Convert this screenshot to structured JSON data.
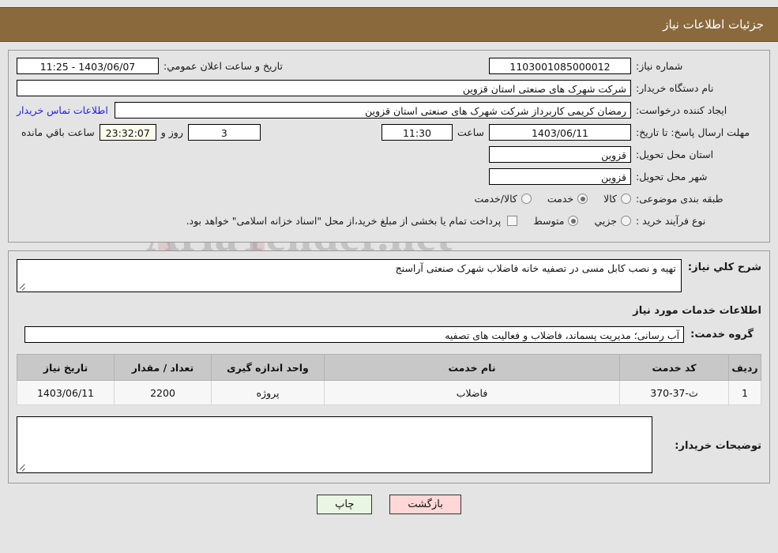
{
  "header": {
    "title": "جزئیات اطلاعات نیاز"
  },
  "form": {
    "need_number_label": "شماره نیاز:",
    "need_number_value": "1103001085000012",
    "public_announce_label": "تاریخ و ساعت اعلان عمومي:",
    "public_announce_value": "1403/06/07 - 11:25",
    "buyer_org_label": "نام دستگاه خریدار:",
    "buyer_org_value": "شرکت شهرک های صنعتی استان قزوین",
    "creator_label": "ایجاد کننده درخواست:",
    "creator_value": "رمضان کریمی کاربرداز شرکت شهرک های صنعتی استان قزوین",
    "contact_link": "اطلاعات تماس خریدار",
    "deadline_label": "مهلت ارسال پاسخ: تا تاریخ:",
    "deadline_date": "1403/06/11",
    "deadline_hour_label": "ساعت",
    "deadline_hour_value": "11:30",
    "remaining_days_value": "3",
    "remaining_days_label": "روز و",
    "remaining_time_value": "23:32:07",
    "remaining_time_label": "ساعت باقي مانده",
    "province_label": "استان محل تحویل:",
    "province_value": "قزوین",
    "city_label": "شهر محل تحویل:",
    "city_value": "قزوین",
    "category_label": "طبقه بندی موضوعی:",
    "category_options": [
      {
        "label": "کالا",
        "selected": false
      },
      {
        "label": "خدمت",
        "selected": true
      },
      {
        "label": "کالا/خدمت",
        "selected": false
      }
    ],
    "process_label": "نوع فرآیند خرید :",
    "process_options": [
      {
        "label": "جزیي",
        "selected": false
      },
      {
        "label": "متوسط",
        "selected": true
      }
    ],
    "treasury_checkbox_checked": false,
    "treasury_note": "پرداخت تمام یا بخشی از مبلغ خرید،از محل \"اسناد خزانه اسلامی\" خواهد بود."
  },
  "details": {
    "general_desc_label": "شرح کلي نیاز:",
    "general_desc_value": "تهیه و نصب کابل مسی در تصفیه خانه فاضلاب شهرک صنعتی آراسنج",
    "section_title": "اطلاعات خدمات مورد نیاز",
    "service_group_label": "گروه خدمت:",
    "service_group_value": "آب رسانی؛ مدیریت پسماند، فاضلاب و فعالیت های تصفیه",
    "buyer_notes_label": "توضیحات خریدار:",
    "buyer_notes_value": ""
  },
  "table": {
    "columns": [
      "ردیف",
      "کد خدمت",
      "نام خدمت",
      "واحد اندازه گیری",
      "تعداد / مقدار",
      "تاریخ نیاز"
    ],
    "rows": [
      {
        "index": "1",
        "code": "ث-37-370",
        "name": "فاضلاب",
        "unit": "پروژه",
        "quantity": "2200",
        "date": "1403/06/11"
      }
    ]
  },
  "buttons": {
    "print": "چاپ",
    "back": "بازگشت"
  },
  "watermark": {
    "text": "AriaTender.net"
  }
}
